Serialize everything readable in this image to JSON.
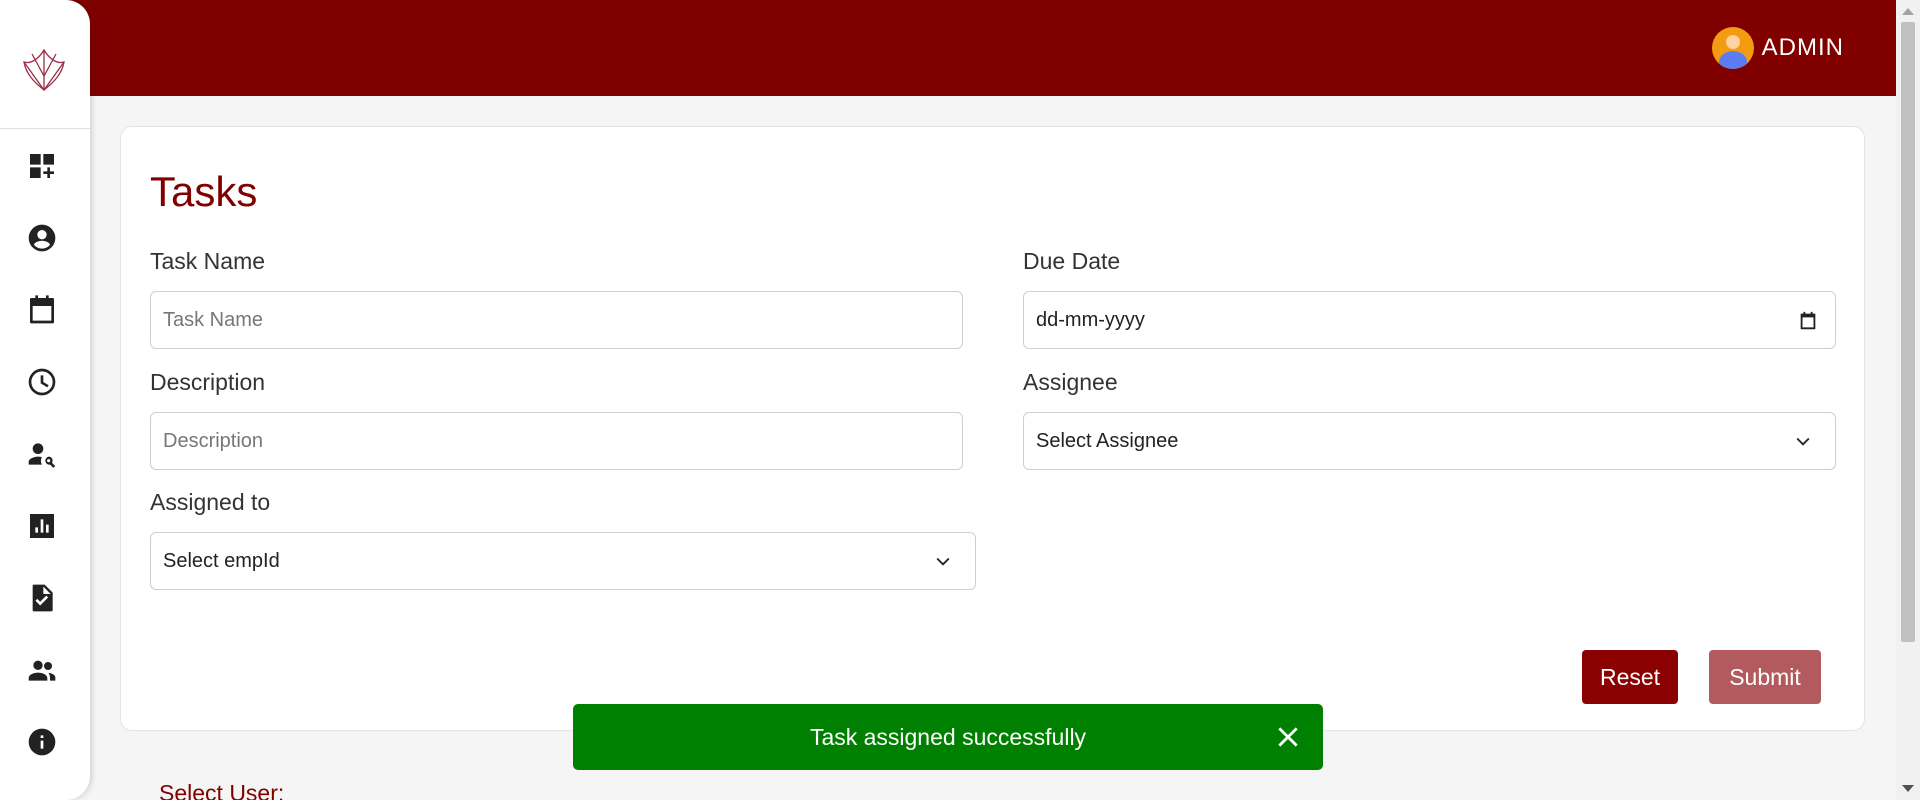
{
  "header": {
    "user_label": "ADMIN",
    "background_color": "#800000"
  },
  "sidebar": {
    "items": [
      {
        "icon": "dashboard-add-icon"
      },
      {
        "icon": "account-circle-icon"
      },
      {
        "icon": "calendar-icon"
      },
      {
        "icon": "clock-icon"
      },
      {
        "icon": "person-search-icon"
      },
      {
        "icon": "bar-chart-icon"
      },
      {
        "icon": "task-document-icon"
      },
      {
        "icon": "people-icon"
      },
      {
        "icon": "info-icon"
      }
    ]
  },
  "form": {
    "title": "Tasks",
    "task_name_label": "Task Name",
    "task_name_placeholder": "Task Name",
    "due_date_label": "Due Date",
    "due_date_value": "dd-mm-yyyy",
    "description_label": "Description",
    "description_placeholder": "Description",
    "assignee_label": "Assignee",
    "assignee_value": "Select Assignee",
    "assigned_to_label": "Assigned to",
    "assigned_to_value": "Select empId",
    "reset_label": "Reset",
    "submit_label": "Submit"
  },
  "toast": {
    "message": "Task assigned successfully",
    "color": "#008000"
  },
  "below": {
    "select_user_label": "Select User:"
  },
  "colors": {
    "accent": "#800000",
    "reset_button": "#8b0000",
    "submit_button": "#b35a5e"
  }
}
